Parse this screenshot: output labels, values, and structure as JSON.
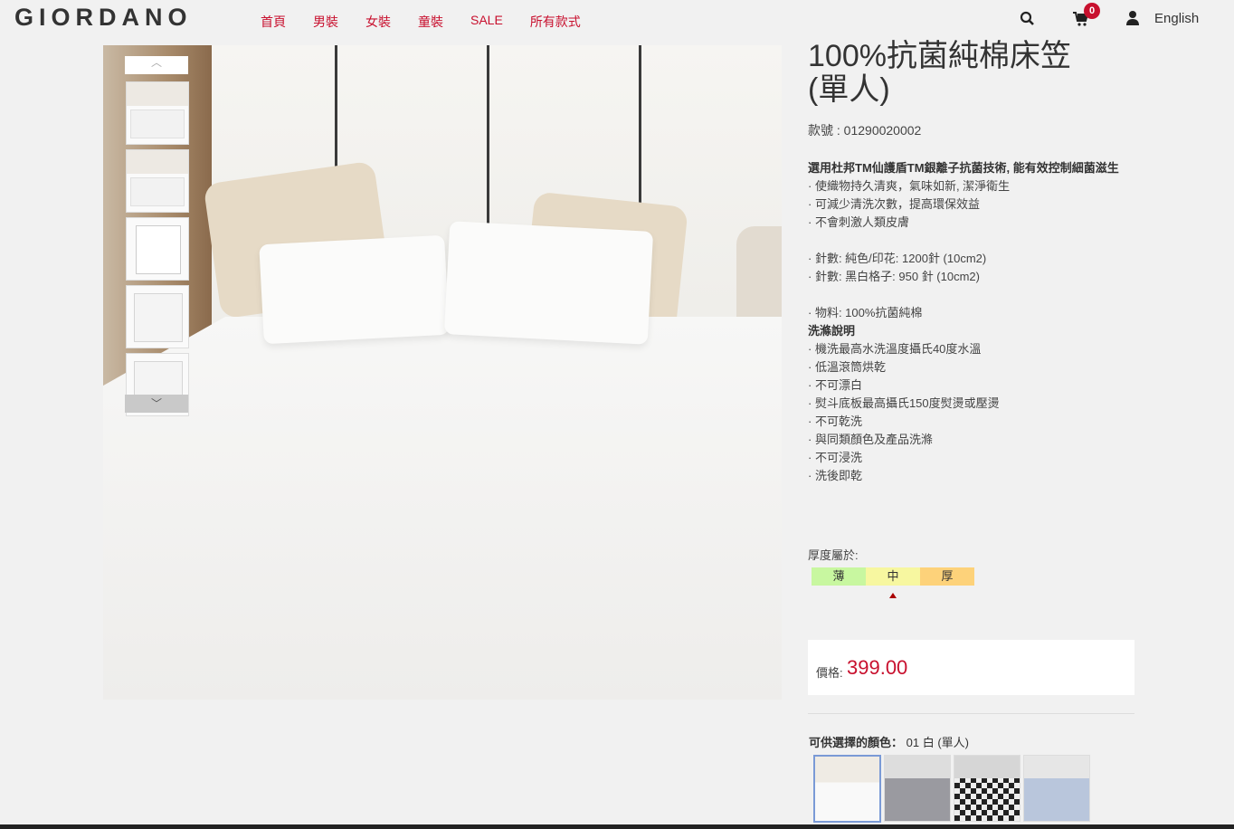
{
  "header": {
    "logo": "GIORDANO",
    "nav": [
      "首頁",
      "男裝",
      "女裝",
      "童裝",
      "SALE",
      "所有款式"
    ],
    "cart_count": "0",
    "language": "English",
    "icons": [
      "search-icon",
      "cart-icon",
      "user-icon"
    ]
  },
  "product": {
    "title_line1": "100%抗菌純棉床笠",
    "title_line2": "(單人)",
    "sku": "款號 : 01290020002",
    "headline": "選用杜邦TM仙護盾TM銀離子抗菌技術, 能有效控制細菌滋生",
    "features": [
      "·  使織物持久清爽，氣味如新, 潔淨衛生",
      "·  可減少清洗次數，提高環保效益",
      "·  不會刺激人類皮膚"
    ],
    "specs": [
      "·  針數: 純色/印花: 1200針 (10cm2)",
      "·  針數: 黑白格子: 950 針 (10cm2)"
    ],
    "material": "·  物料: 100%抗菌純棉",
    "care_title": "洗滌說明",
    "care": [
      "·  機洗最高水洗溫度攝氏40度水溫",
      "·  低溫滾筒烘乾",
      "·  不可漂白",
      "·  熨斗底板最高攝氏150度熨燙或壓燙",
      "·  不可乾洗",
      "·  與同類顏色及產品洗滌",
      "·  不可浸洗",
      "·  洗後即乾"
    ],
    "thickness_label": "厚度屬於:",
    "thickness_levels": [
      "薄",
      "中",
      "厚"
    ],
    "thickness_selected": "中",
    "price_label": "價格:",
    "price": "399.00",
    "color_label": "可供選擇的顏色：",
    "color_selected": "01 白 (單人)"
  },
  "colors": {
    "brand": "#c8102e",
    "thin": "#c8f7a0",
    "medium": "#f7f7a0",
    "thick": "#fdd27a"
  },
  "gallery": {
    "thumb_up": "^",
    "thumb_down": "v"
  }
}
